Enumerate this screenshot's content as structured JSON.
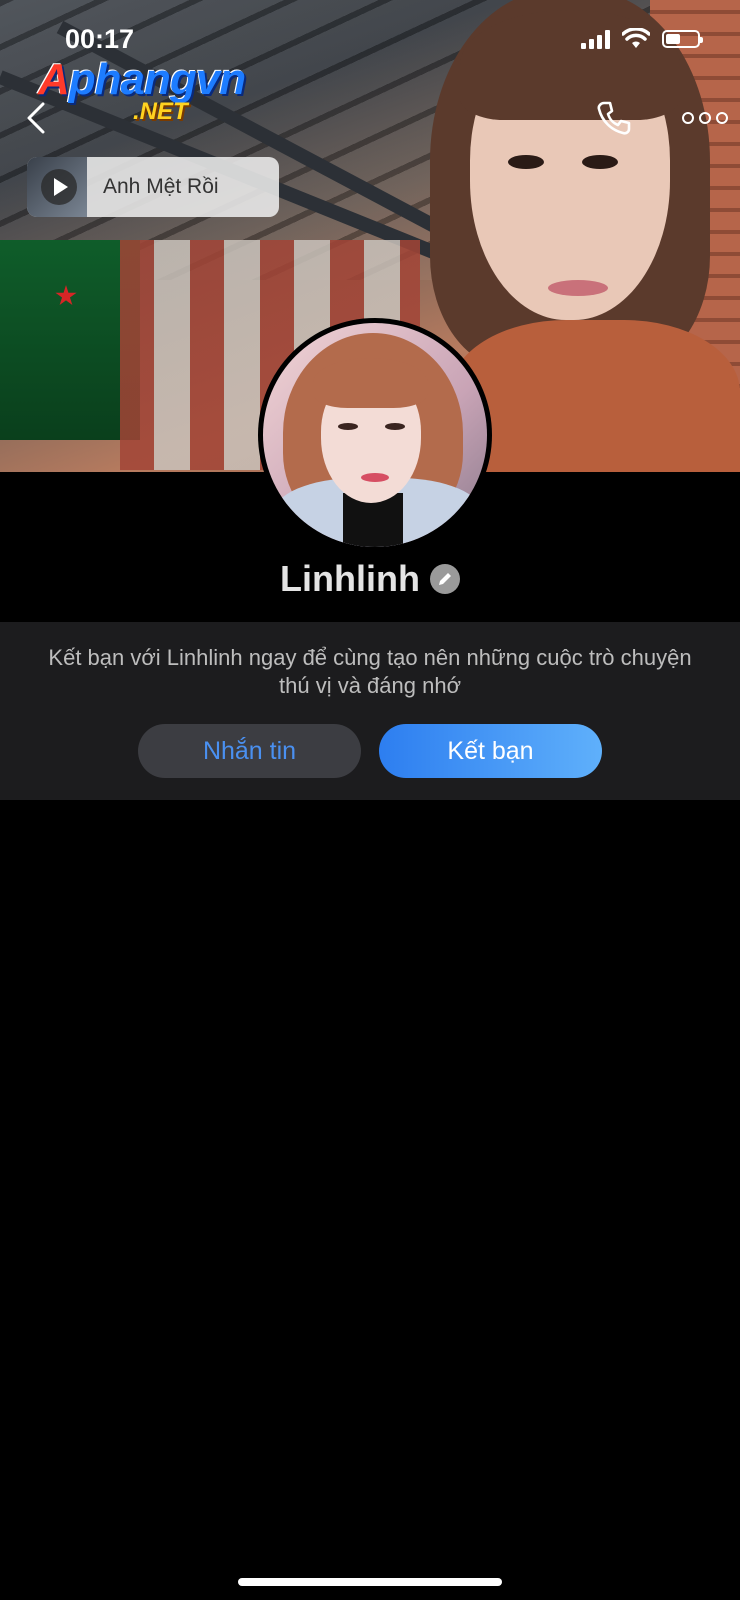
{
  "status_bar": {
    "time": "00:17",
    "icons": [
      "cellular-signal-icon",
      "wifi-icon",
      "battery-icon"
    ],
    "battery_level": 0.45
  },
  "watermark": {
    "logo_main": "Aphangvn",
    "logo_suffix": ".NET"
  },
  "nav": {
    "back_icon": "chevron-left-icon",
    "call_icon": "phone-icon",
    "more_icon": "more-dots-icon"
  },
  "music": {
    "title": "Anh Mệt Rồi",
    "play_icon": "play-icon"
  },
  "profile": {
    "name": "Linhlinh",
    "edit_icon": "pencil-icon"
  },
  "friend_prompt": {
    "text": "Kết bạn với Linhlinh ngay để cùng tạo nên những cuộc trò chuyện thú vị và đáng nhớ",
    "message_label": "Nhắn tin",
    "add_friend_label": "Kết bạn"
  },
  "colors": {
    "accent_blue": "#2d7ef0",
    "panel_bg": "#1c1c1e",
    "message_button_bg": "#3c3d42"
  }
}
